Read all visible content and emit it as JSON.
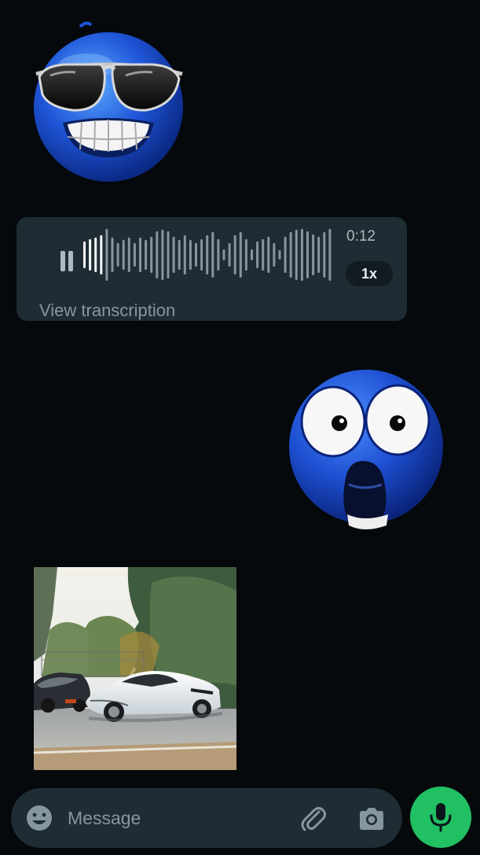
{
  "chat": {
    "messages": [
      {
        "type": "sticker",
        "name": "cool-sunglasses-emoji"
      },
      {
        "type": "voice",
        "duration": "0:12",
        "speed": "1x",
        "transcription_link": "View transcription",
        "state": "playing"
      },
      {
        "type": "sticker",
        "name": "shocked-emoji"
      },
      {
        "type": "image",
        "subject": "white sports car photo"
      }
    ]
  },
  "input_bar": {
    "placeholder": "Message",
    "icons": {
      "emoji": "smiley-icon",
      "attach": "paperclip-icon",
      "camera": "camera-icon",
      "mic": "microphone-icon"
    }
  },
  "colors": {
    "background": "#05090c",
    "bubble": "#1f2c33",
    "accent_green": "#21c063",
    "secondary_text": "#8696a0",
    "sticker_blue": "#1f55d8"
  }
}
